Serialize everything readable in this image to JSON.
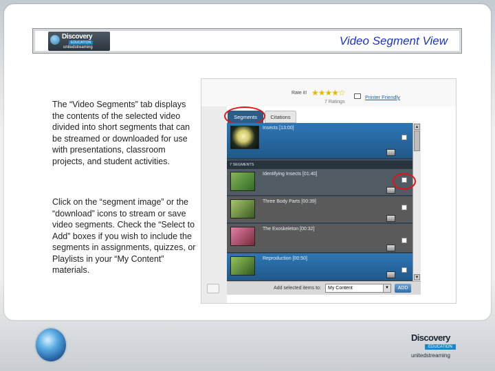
{
  "header": {
    "title": "Video Segment View",
    "logo_text": "Discovery",
    "logo_edu": "EDUCATION",
    "logo_sub": "unitedstreaming"
  },
  "body": {
    "paragraph1": "The “Video Segments” tab displays the contents of the selected video divided into short segments that can be streamed or downloaded for use with presentations, classroom projects, and student activities.",
    "paragraph2": "Click on the “segment image” or the “download” icons to stream or save video segments. Check the “Select to Add” boxes if you wish to include the segments in assignments, quizzes, or Playlists in your “My Content” materials."
  },
  "screenshot": {
    "rate_label": "Rate it!",
    "stars": "★★★★☆",
    "ratings_count": "7 Ratings",
    "printer_link": "Printer Friendly",
    "tabs": [
      "Segments",
      "Citations"
    ],
    "segment_count_label": "7 SEGMENTS",
    "segments": [
      {
        "label": "Insects [13:00]"
      },
      {
        "label": "Identifying Insects [01:40]"
      },
      {
        "label": "Three Body Parts [00:39]"
      },
      {
        "label": "The Exoskeleton [00:32]"
      },
      {
        "label": "Reproduction [00:50]"
      }
    ],
    "add_label": "Add selected items to:",
    "add_select_value": "My Content",
    "add_button": "ADD"
  },
  "footer": {
    "logo_text": "Discovery",
    "logo_edu": "EDUCATION",
    "logo_sub": "unitedstreaming"
  },
  "colors": {
    "title_blue": "#1a33c4",
    "highlight_red": "#e01414",
    "segment_active": "#2d76b4"
  }
}
